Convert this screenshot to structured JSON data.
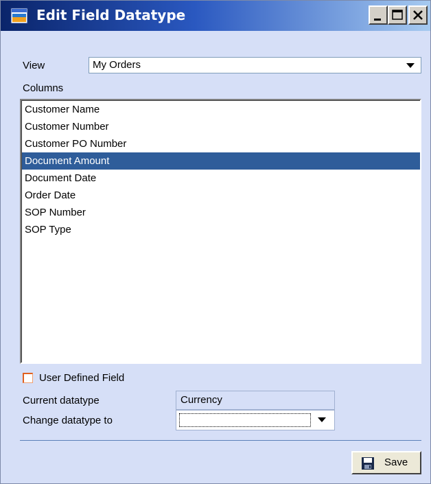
{
  "window": {
    "title": "Edit Field Datatype",
    "title_icon": "window-app-icon",
    "controls": [
      "minimize-icon",
      "maximize-icon",
      "close-icon"
    ]
  },
  "view": {
    "label": "View",
    "selected": "My Orders"
  },
  "columns": {
    "label": "Columns",
    "items": [
      "Customer Name",
      "Customer Number",
      "Customer PO Number",
      "Document Amount",
      "Document Date",
      "Order Date",
      "SOP Number",
      "SOP Type"
    ],
    "selected_index": 3
  },
  "user_defined": {
    "label": "User Defined Field",
    "checked": false
  },
  "current_datatype": {
    "label": "Current datatype",
    "value": "Currency"
  },
  "change_datatype": {
    "label": "Change datatype to",
    "value": ""
  },
  "save": {
    "label": "Save",
    "icon": "floppy-disk-icon"
  },
  "colors": {
    "selection": "#2f5d9a",
    "window_bg": "#d6dff7",
    "titlebar_dark": "#0a246a"
  }
}
